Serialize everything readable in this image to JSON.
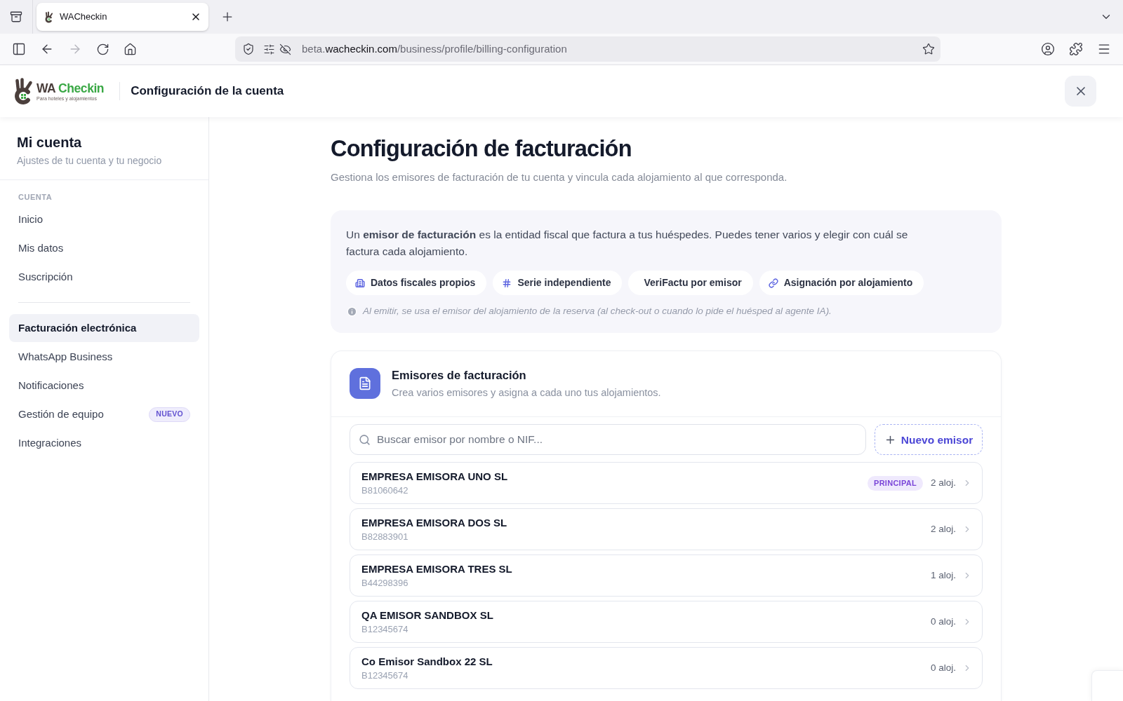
{
  "browser": {
    "tabs": [
      {
        "title": "WACheckin",
        "selected": true
      }
    ],
    "forward_disabled": true,
    "url": {
      "host_prefix": "beta.",
      "domain": "wacheckin.com",
      "path": "/business/profile/billing-configuration"
    }
  },
  "header": {
    "logo": {
      "brand_dark": "WA",
      "brand_green": "Checkin",
      "tagline": "Para hoteles y alojamientos"
    },
    "title": "Configuración de la cuenta"
  },
  "sidebar": {
    "title": "Mi cuenta",
    "subtitle": "Ajustes de tu cuenta y tu negocio",
    "section_label": "CUENTA",
    "groups": [
      {
        "items": [
          {
            "label": "Inicio",
            "selected": false
          },
          {
            "label": "Mis datos",
            "selected": false
          },
          {
            "label": "Suscripción",
            "selected": false
          }
        ]
      },
      {
        "items": [
          {
            "label": "Facturación electrónica",
            "selected": true
          },
          {
            "label": "WhatsApp Business",
            "selected": false
          },
          {
            "label": "Notificaciones",
            "selected": false
          },
          {
            "label": "Gestión de equipo",
            "selected": false,
            "badge": "NUEVO"
          },
          {
            "label": "Integraciones",
            "selected": false
          }
        ]
      }
    ]
  },
  "page": {
    "title": "Configuración de facturación",
    "subtitle": "Gestiona los emisores de facturación de tu cuenta y vincula cada alojamiento al que corresponda."
  },
  "info": {
    "text": "Un **emisor de facturación** es la entidad fiscal que factura a tus huéspedes. Puedes tener varios y elegir con cuál se factura cada alojamiento.",
    "chips": [
      {
        "label": "Datos fiscales propios"
      },
      {
        "label": "Serie independiente"
      },
      {
        "label": "VeriFactu por emisor"
      },
      {
        "label": "Asignación por alojamiento"
      }
    ],
    "note": "Al emitir, se usa el emisor del alojamiento de la reserva (al check-out o cuando lo pide el huésped al agente IA)."
  },
  "issuers": {
    "title": "Emisores de facturación",
    "subtitle": "Crea varios emisores y asigna a cada uno tus alojamientos.",
    "search": {
      "placeholder": "Buscar emisor por nombre o NIF..."
    },
    "new_button": "Nuevo emisor",
    "rows": [
      {
        "name": "EMPRESA EMISORA UNO SL",
        "nif": "B81060642",
        "badge": "PRINCIPAL",
        "count": "2 aloj."
      },
      {
        "name": "EMPRESA EMISORA DOS SL",
        "nif": "B82883901",
        "count": "2 aloj."
      },
      {
        "name": "EMPRESA EMISORA TRES SL",
        "nif": "B44298396",
        "count": "1 aloj."
      },
      {
        "name": "QA EMISOR SANDBOX SL",
        "nif": "B12345674",
        "count": "0 aloj."
      },
      {
        "name": "Co Emisor Sandbox 22 SL",
        "nif": "B12345674",
        "count": "0 aloj."
      }
    ]
  }
}
